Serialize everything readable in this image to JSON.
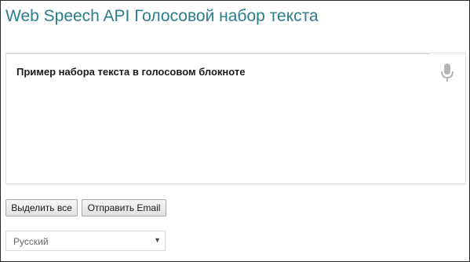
{
  "header": {
    "title": "Web Speech API Голосовой набор текста"
  },
  "editor": {
    "text": "Пример набора текста в голосовом блокноте",
    "mic_icon": "microphone-icon"
  },
  "actions": {
    "select_all_label": "Выделить все",
    "send_email_label": "Отправить Email"
  },
  "language": {
    "selected": "Русский",
    "chevron_icon": "chevron-down-icon"
  },
  "colors": {
    "title": "#2a7d8c",
    "text": "#1a1a1a",
    "mic": "#b5b5b5",
    "frame_border": "#2b2b2b"
  }
}
